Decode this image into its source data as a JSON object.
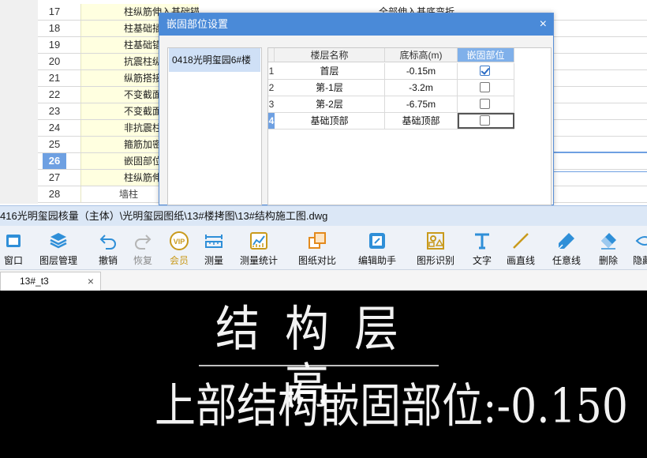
{
  "settings_table": {
    "rows": [
      {
        "num": "17",
        "label": "柱纵筋伸入基础锚固形式",
        "value": "全部伸入基底弯折"
      },
      {
        "num": "18",
        "label": "柱基础插筋弯折长度",
        "value": ""
      },
      {
        "num": "19",
        "label": "柱基础锚固区只计算",
        "value": ""
      },
      {
        "num": "20",
        "label": "抗震柱纵筋露出长度",
        "value": ""
      },
      {
        "num": "21",
        "label": "纵筋搭接范围箍筋间距",
        "value": ""
      },
      {
        "num": "22",
        "label": "不变截面上柱多出的",
        "value": ""
      },
      {
        "num": "23",
        "label": "不变截面下柱多出的",
        "value": ""
      },
      {
        "num": "24",
        "label": "非抗震柱纵筋露出长度",
        "value": ""
      },
      {
        "num": "25",
        "label": "箍筋加密区设置",
        "value": ""
      },
      {
        "num": "26",
        "label": "嵌固部位设置",
        "value": ""
      },
      {
        "num": "27",
        "label": "柱纵筋伸入上层预留",
        "value": ""
      },
      {
        "num": "28",
        "label": "墙柱",
        "value": "",
        "group": true
      }
    ],
    "active_row": "26"
  },
  "dialog": {
    "title": "嵌固部位设置",
    "close_glyph": "×",
    "project": "0418光明玺园6#楼",
    "columns": [
      "楼层名称",
      "底标高(m)",
      "嵌固部位"
    ],
    "floors": [
      {
        "rn": "1",
        "name": "首层",
        "elevation": "-0.15m",
        "checked": true
      },
      {
        "rn": "2",
        "name": "第-1层",
        "elevation": "-3.2m",
        "checked": false
      },
      {
        "rn": "3",
        "name": "第-2层",
        "elevation": "-6.75m",
        "checked": false
      },
      {
        "rn": "4",
        "name": "基础顶部",
        "elevation": "基础顶部",
        "checked": false
      }
    ]
  },
  "path_bar": {
    "text": "416光明玺园核量（主体）\\光明玺园图纸\\13#楼拷图\\13#结构施工图.dwg"
  },
  "toolbar": {
    "items": [
      {
        "label": "窗口",
        "icon": "window-icon"
      },
      {
        "label": "图层管理",
        "icon": "layers-icon"
      },
      {
        "label": "撤销",
        "icon": "undo-icon"
      },
      {
        "label": "恢复",
        "icon": "redo-icon"
      },
      {
        "label": "会员",
        "icon": "vip-icon"
      },
      {
        "label": "测量",
        "icon": "ruler-icon"
      },
      {
        "label": "测量统计",
        "icon": "measure-stats-icon"
      },
      {
        "label": "图纸对比",
        "icon": "compare-icon"
      },
      {
        "label": "编辑助手",
        "icon": "edit-assistant-icon"
      },
      {
        "label": "图形识别",
        "icon": "shape-recognize-icon"
      },
      {
        "label": "文字",
        "icon": "text-icon"
      },
      {
        "label": "画直线",
        "icon": "line-icon"
      },
      {
        "label": "任意线",
        "icon": "freehand-icon"
      },
      {
        "label": "删除",
        "icon": "eraser-icon"
      },
      {
        "label": "隐藏",
        "icon": "hide-icon"
      }
    ]
  },
  "tabs": {
    "doc_name": "13#_t3",
    "close_glyph": "×"
  },
  "drawing": {
    "title": "结构层高",
    "subtitle": "上部结构嵌固部位:-0.150"
  },
  "colors": {
    "dialog_title": "#4a8ad8",
    "active_row": "#6ea0e2",
    "cell_highlight": "#ffffe0",
    "canvas_bg": "#000000"
  }
}
